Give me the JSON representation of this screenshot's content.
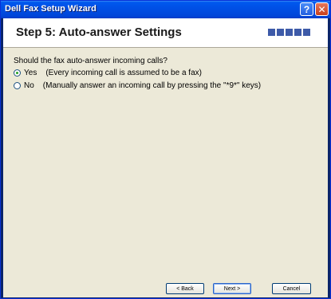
{
  "window": {
    "title": "Dell Fax Setup Wizard",
    "help_glyph": "?",
    "close_glyph": "✕"
  },
  "header": {
    "step_title": "Step 5: Auto-answer Settings",
    "progress_segments": 5
  },
  "question": "Should the fax auto-answer incoming calls?",
  "options": [
    {
      "label": "Yes",
      "description": "(Every incoming call is assumed to be a fax)",
      "selected": true
    },
    {
      "label": "No",
      "description": "(Manually answer an incoming call by pressing the \"*9*\" keys)",
      "selected": false
    }
  ],
  "buttons": {
    "back": "< Back",
    "next": "Next >",
    "cancel": "Cancel"
  },
  "colors": {
    "titlebar": "#0058ee",
    "progress": "#3d5aa8",
    "client_bg": "#ece9d8"
  }
}
